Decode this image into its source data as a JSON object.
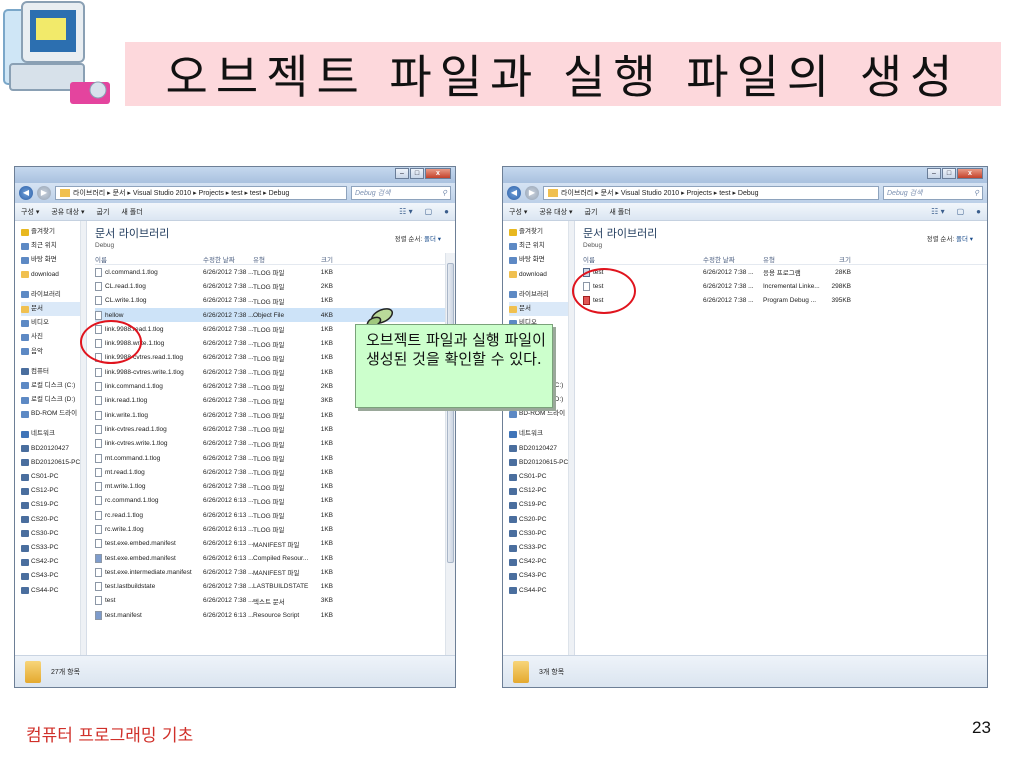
{
  "slide": {
    "title": "오브젝트 파일과 실행 파일의 생성",
    "footer_left": "컴퓨터 프로그래밍 기초",
    "page_number": "23",
    "title_bg_color": "#fdd8dc",
    "footer_color": "#d0302a"
  },
  "callout": {
    "text": "오브젝트 파일과 실행 파일이 생성된 것을 확인할 수 있다.",
    "bg_color": "#ccffcc",
    "icon": "pushpin-icon"
  },
  "left_window": {
    "address": "라이브러리 ▸ 문서 ▸ Visual Studio 2010 ▸ Projects ▸ test ▸ test ▸ Debug",
    "search_placeholder": "Debug 검색",
    "toolbar": {
      "organize": "구성 ▾",
      "share": "공유 대상 ▾",
      "burn": "굽기",
      "new_folder": "새 폴더"
    },
    "nav_items": [
      {
        "label": "즐겨찾기",
        "icon": "star"
      },
      {
        "label": "최근 위치",
        "icon": "recent"
      },
      {
        "label": "바탕 화면",
        "icon": "desktop"
      },
      {
        "label": "download",
        "icon": "folder"
      },
      {
        "label": "라이브러리",
        "icon": "library",
        "top": true
      },
      {
        "label": "문서",
        "icon": "folder",
        "selected": true
      },
      {
        "label": "비디오",
        "icon": "video"
      },
      {
        "label": "사진",
        "icon": "picture"
      },
      {
        "label": "음악",
        "icon": "music"
      },
      {
        "label": "컴퓨터",
        "icon": "pc",
        "top": true
      },
      {
        "label": "로컬 디스크 (C:)",
        "icon": "disk"
      },
      {
        "label": "로컬 디스크 (D:)",
        "icon": "disk"
      },
      {
        "label": "BD-ROM 드라이",
        "icon": "disk"
      },
      {
        "label": "네트워크",
        "icon": "net",
        "top": true
      },
      {
        "label": "BD20120427",
        "icon": "pc"
      },
      {
        "label": "BD20120615-PC",
        "icon": "pc"
      },
      {
        "label": "CS01-PC",
        "icon": "pc"
      },
      {
        "label": "CS12-PC",
        "icon": "pc"
      },
      {
        "label": "CS19-PC",
        "icon": "pc"
      },
      {
        "label": "CS20-PC",
        "icon": "pc"
      },
      {
        "label": "CS30-PC",
        "icon": "pc"
      },
      {
        "label": "CS33-PC",
        "icon": "pc"
      },
      {
        "label": "CS42-PC",
        "icon": "pc"
      },
      {
        "label": "CS43-PC",
        "icon": "pc"
      },
      {
        "label": "CS44-PC",
        "icon": "pc"
      }
    ],
    "library_title": "문서 라이브러리",
    "library_sub": "Debug",
    "sort_label": "정렬 순서:",
    "sort_value": "폴더 ▾",
    "columns": {
      "name": "이름",
      "date": "수정한 날짜",
      "type": "유형",
      "size": "크기"
    },
    "files": [
      {
        "name": "cl.command.1.tlog",
        "date": "6/26/2012 7:38 ...",
        "type": "TLOG 파일",
        "size": "1KB",
        "icon": "file"
      },
      {
        "name": "CL.read.1.tlog",
        "date": "6/26/2012 7:38 ...",
        "type": "TLOG 파일",
        "size": "2KB",
        "icon": "file"
      },
      {
        "name": "CL.write.1.tlog",
        "date": "6/26/2012 7:38 ...",
        "type": "TLOG 파일",
        "size": "1KB",
        "icon": "file"
      },
      {
        "name": "hellow",
        "date": "6/26/2012 7:38 ...",
        "type": "Object File",
        "size": "4KB",
        "icon": "file",
        "selected": true
      },
      {
        "name": "link.9988.read.1.tlog",
        "date": "6/26/2012 7:38 ...",
        "type": "TLOG 파일",
        "size": "1KB",
        "icon": "file"
      },
      {
        "name": "link.9988.write.1.tlog",
        "date": "6/26/2012 7:38 ...",
        "type": "TLOG 파일",
        "size": "1KB",
        "icon": "file"
      },
      {
        "name": "link.9988-cvtres.read.1.tlog",
        "date": "6/26/2012 7:38 ...",
        "type": "TLOG 파일",
        "size": "1KB",
        "icon": "file"
      },
      {
        "name": "link.9988-cvtres.write.1.tlog",
        "date": "6/26/2012 7:38 ...",
        "type": "TLOG 파일",
        "size": "1KB",
        "icon": "file"
      },
      {
        "name": "link.command.1.tlog",
        "date": "6/26/2012 7:38 ...",
        "type": "TLOG 파일",
        "size": "2KB",
        "icon": "file"
      },
      {
        "name": "link.read.1.tlog",
        "date": "6/26/2012 7:38 ...",
        "type": "TLOG 파일",
        "size": "3KB",
        "icon": "file"
      },
      {
        "name": "link.write.1.tlog",
        "date": "6/26/2012 7:38 ...",
        "type": "TLOG 파일",
        "size": "1KB",
        "icon": "file"
      },
      {
        "name": "link-cvtres.read.1.tlog",
        "date": "6/26/2012 7:38 ...",
        "type": "TLOG 파일",
        "size": "1KB",
        "icon": "file"
      },
      {
        "name": "link-cvtres.write.1.tlog",
        "date": "6/26/2012 7:38 ...",
        "type": "TLOG 파일",
        "size": "1KB",
        "icon": "file"
      },
      {
        "name": "mt.command.1.tlog",
        "date": "6/26/2012 7:38 ...",
        "type": "TLOG 파일",
        "size": "1KB",
        "icon": "file"
      },
      {
        "name": "mt.read.1.tlog",
        "date": "6/26/2012 7:38 ...",
        "type": "TLOG 파일",
        "size": "1KB",
        "icon": "file"
      },
      {
        "name": "mt.write.1.tlog",
        "date": "6/26/2012 7:38 ...",
        "type": "TLOG 파일",
        "size": "1KB",
        "icon": "file"
      },
      {
        "name": "rc.command.1.tlog",
        "date": "6/26/2012 6:13 ...",
        "type": "TLOG 파일",
        "size": "1KB",
        "icon": "file"
      },
      {
        "name": "rc.read.1.tlog",
        "date": "6/26/2012 6:13 ...",
        "type": "TLOG 파일",
        "size": "1KB",
        "icon": "file"
      },
      {
        "name": "rc.write.1.tlog",
        "date": "6/26/2012 6:13 ...",
        "type": "TLOG 파일",
        "size": "1KB",
        "icon": "file"
      },
      {
        "name": "test.exe.embed.manifest",
        "date": "6/26/2012 6:13 ...",
        "type": "MANIFEST 파일",
        "size": "1KB",
        "icon": "file"
      },
      {
        "name": "test.exe.embed.manifest",
        "date": "6/26/2012 6:13 ...",
        "type": "Compiled Resour...",
        "size": "1KB",
        "icon": "manifest"
      },
      {
        "name": "test.exe.intermediate.manifest",
        "date": "6/26/2012 7:38 ...",
        "type": "MANIFEST 파일",
        "size": "1KB",
        "icon": "file"
      },
      {
        "name": "test.lastbuildstate",
        "date": "6/26/2012 7:38 ...",
        "type": "LASTBUILDSTATE ...",
        "size": "1KB",
        "icon": "file"
      },
      {
        "name": "test",
        "date": "6/26/2012 7:38 ...",
        "type": "텍스트 문서",
        "size": "3KB",
        "icon": "file"
      },
      {
        "name": "test.manifest",
        "date": "6/26/2012 6:13 ...",
        "type": "Resource Script",
        "size": "1KB",
        "icon": "manifest"
      }
    ],
    "status": "27개 항목"
  },
  "right_window": {
    "address": "라이브러리 ▸ 문서 ▸ Visual Studio 2010 ▸ Projects ▸ test ▸ Debug",
    "search_placeholder": "Debug 검색",
    "toolbar": {
      "organize": "구성 ▾",
      "share": "공유 대상 ▾",
      "burn": "굽기",
      "new_folder": "새 폴더"
    },
    "nav_items": [
      {
        "label": "즐겨찾기",
        "icon": "star"
      },
      {
        "label": "최근 위치",
        "icon": "recent"
      },
      {
        "label": "바탕 화면",
        "icon": "desktop"
      },
      {
        "label": "download",
        "icon": "folder"
      },
      {
        "label": "라이브러리",
        "icon": "library",
        "top": true
      },
      {
        "label": "문서",
        "icon": "folder",
        "selected": true
      },
      {
        "label": "비디오",
        "icon": "video"
      },
      {
        "label": "사진",
        "icon": "picture"
      },
      {
        "label": "음악",
        "icon": "music"
      },
      {
        "label": "컴퓨터",
        "icon": "pc",
        "top": true
      },
      {
        "label": "로컬 디스크 (C:)",
        "icon": "disk"
      },
      {
        "label": "로컬 디스크 (D:)",
        "icon": "disk"
      },
      {
        "label": "BD-ROM 드라이",
        "icon": "disk"
      },
      {
        "label": "네트워크",
        "icon": "net",
        "top": true
      },
      {
        "label": "BD20120427",
        "icon": "pc"
      },
      {
        "label": "BD20120615-PC",
        "icon": "pc"
      },
      {
        "label": "CS01-PC",
        "icon": "pc"
      },
      {
        "label": "CS12-PC",
        "icon": "pc"
      },
      {
        "label": "CS19-PC",
        "icon": "pc"
      },
      {
        "label": "CS20-PC",
        "icon": "pc"
      },
      {
        "label": "CS30-PC",
        "icon": "pc"
      },
      {
        "label": "CS33-PC",
        "icon": "pc"
      },
      {
        "label": "CS42-PC",
        "icon": "pc"
      },
      {
        "label": "CS43-PC",
        "icon": "pc"
      },
      {
        "label": "CS44-PC",
        "icon": "pc"
      }
    ],
    "library_title": "문서 라이브러리",
    "library_sub": "Debug",
    "sort_label": "정렬 순서:",
    "sort_value": "폴더 ▾",
    "columns": {
      "name": "이름",
      "date": "수정한 날짜",
      "type": "유형",
      "size": "크기"
    },
    "files": [
      {
        "name": "test",
        "date": "6/26/2012 7:38 ...",
        "type": "응용 프로그램",
        "size": "28KB",
        "icon": "exe"
      },
      {
        "name": "test",
        "date": "6/26/2012 7:38 ...",
        "type": "Incremental Linke...",
        "size": "298KB",
        "icon": "file"
      },
      {
        "name": "test",
        "date": "6/26/2012 7:38 ...",
        "type": "Program Debug ...",
        "size": "395KB",
        "icon": "pdb"
      }
    ],
    "status": "3개 항목"
  }
}
